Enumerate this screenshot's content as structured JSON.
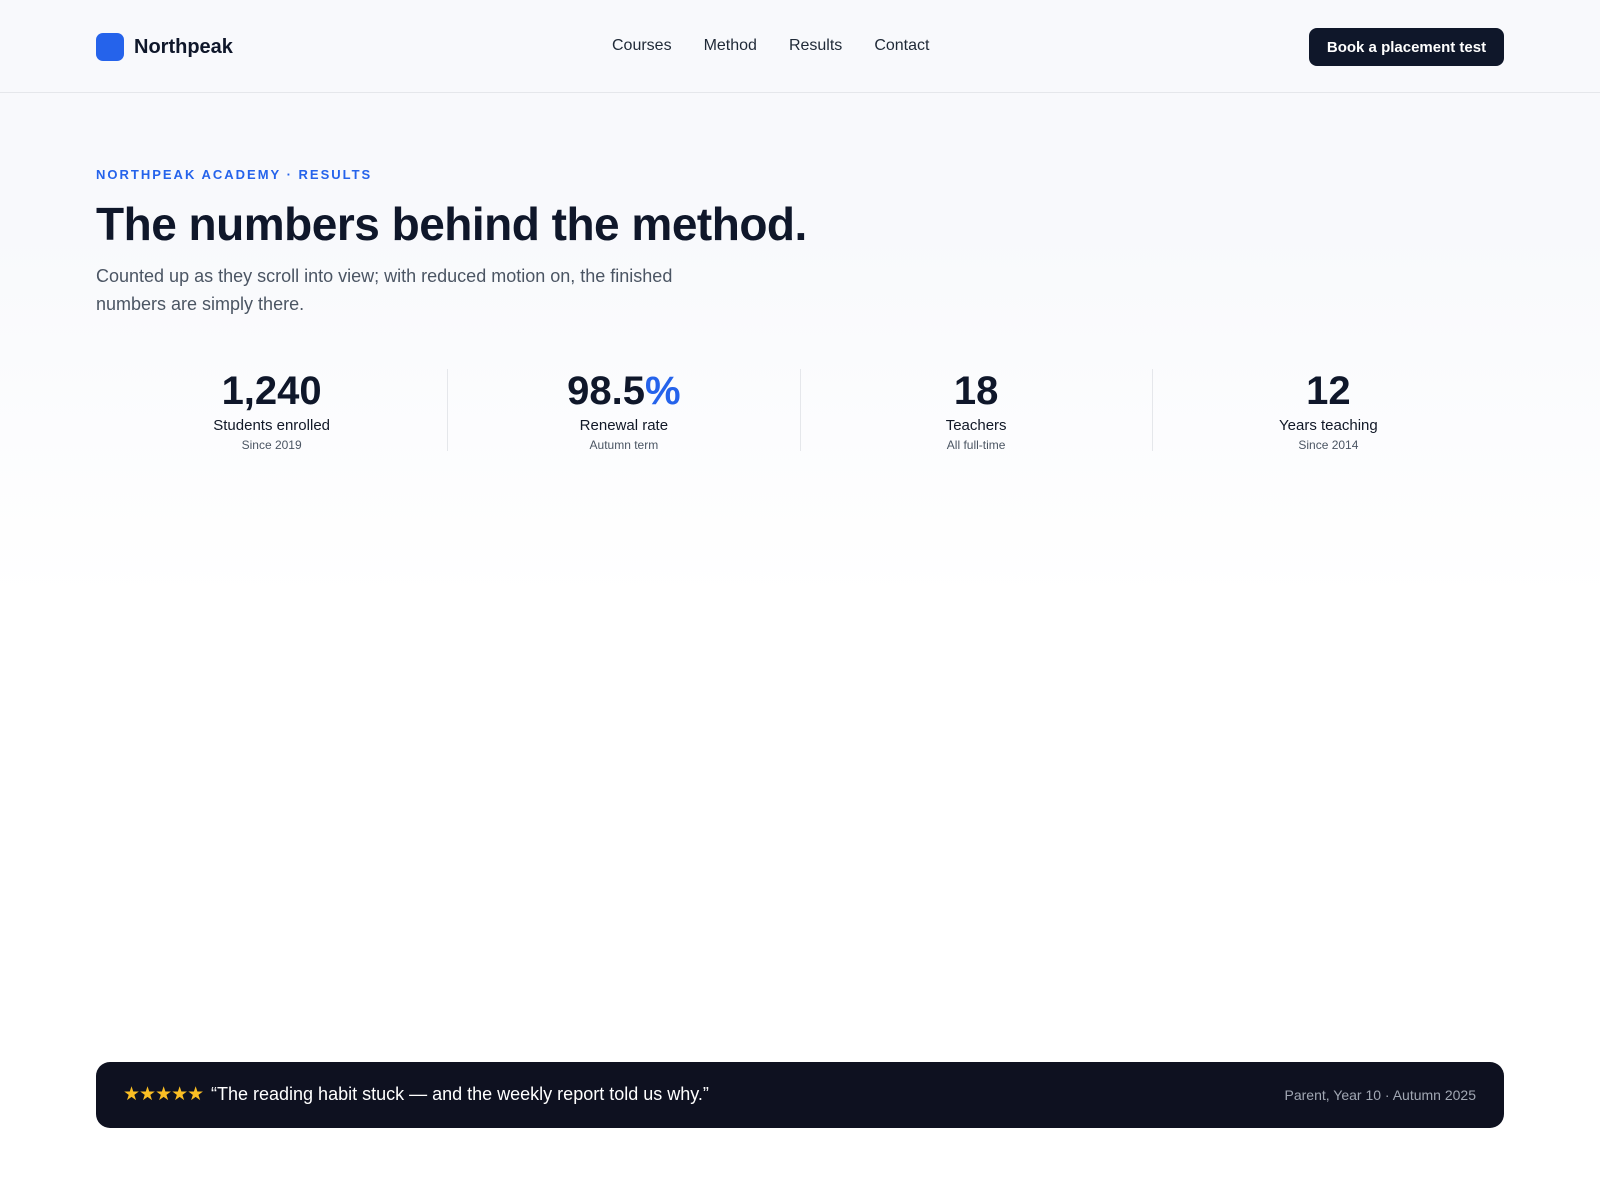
{
  "header": {
    "brand_name": "Northpeak",
    "nav": [
      "Courses",
      "Method",
      "Results",
      "Contact"
    ],
    "cta_label": "Book a placement test"
  },
  "hero": {
    "eyebrow": "NORTHPEAK ACADEMY · RESULTS",
    "title": "The numbers behind the method.",
    "lede": "Counted up as they scroll into view; with reduced motion on, the finished numbers are simply there."
  },
  "stats": [
    {
      "value": "1,240",
      "suffix": "",
      "label": "Students enrolled",
      "sub": "Since 2019"
    },
    {
      "value": "98.5",
      "suffix": "%",
      "label": "Renewal rate",
      "sub": "Autumn term"
    },
    {
      "value": "18",
      "suffix": "",
      "label": "Teachers",
      "sub": "All full-time"
    },
    {
      "value": "12",
      "suffix": "",
      "label": "Years teaching",
      "sub": "Since 2014"
    }
  ],
  "testimonial": {
    "stars": "★★★★★",
    "rating": 5,
    "quote": "“The reading habit stuck — and the weekly report told us why.”",
    "attribution": "Parent, Year 10 · Autumn 2025"
  },
  "colors": {
    "accent": "#2563eb",
    "ink": "#0f172a",
    "star": "#fbbf24",
    "testimonial_bg": "#0e1120"
  }
}
